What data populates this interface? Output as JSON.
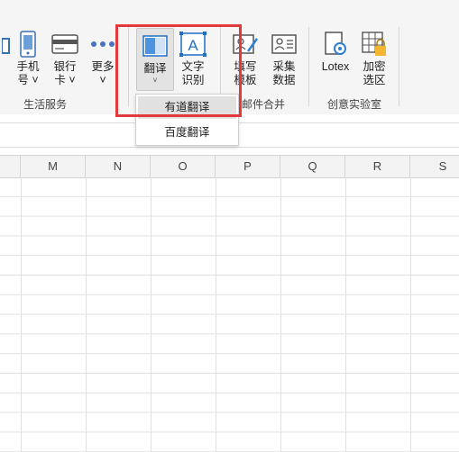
{
  "ribbon": {
    "buttons": {
      "phone": "手机\n号 ˅",
      "bankcard": "银行\n卡 ˅",
      "more": "更多\n˅",
      "translate": "翻译",
      "ocr": "文字\n识别",
      "fill_template": "填写\n模板",
      "collect_data": "采集\n数据",
      "lotex": "Lotex",
      "encrypt": "加密\n选区"
    },
    "groups": {
      "life_services": "生活服务",
      "mail_merge": "邮件合并",
      "creative_lab": "创意实验室"
    }
  },
  "translate_menu": {
    "items": [
      "有道翻译",
      "百度翻译"
    ]
  },
  "columns": [
    "M",
    "N",
    "O",
    "P",
    "Q",
    "R",
    "S"
  ],
  "colors": {
    "highlight": "#e23a3a",
    "accent": "#1f6fc5"
  }
}
